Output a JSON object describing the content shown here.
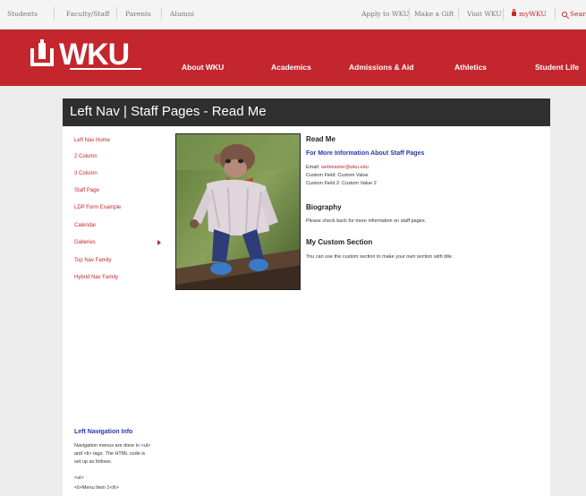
{
  "topbar": {
    "students": "Students",
    "faculty": "Faculty/Staff",
    "parents": "Parents",
    "alumni": "Alumni",
    "apply": "Apply to WKU",
    "gift": "Make a Gift",
    "visit": "Visit WKU",
    "mywku": "myWKU",
    "search": "Search"
  },
  "header": {
    "logo": "WKU",
    "nav": [
      "About WKU",
      "Academics",
      "Admissions & Aid",
      "Athletics",
      "Student Life"
    ]
  },
  "page": {
    "title": "Left Nav | Staff Pages - Read Me"
  },
  "leftnav": {
    "items": [
      "Left Nav Home",
      "2 Column",
      "3 Column",
      "Staff Page",
      "LDP Form Example",
      "Calendar",
      "Galleries",
      "Top Nav Family",
      "Hybrid Nav Family"
    ]
  },
  "readme": {
    "heading": "Read Me",
    "more_info": "For More Information About Staff Pages",
    "email_label": "Email:",
    "email": "webmaster@wku.edu",
    "custom1": "Custom Field:  Custom Value",
    "custom2": "Custom Field 2:  Custom Value 2",
    "bio_heading": "Biography",
    "bio_text": "Please check back for more information on staff pages.",
    "custom_heading": "My Custom Section",
    "custom_text": "You can use the custom section to make your own section with title."
  },
  "navinfo": {
    "heading": "Left Navigation Info",
    "lines": [
      "Navigation menus are done in <ul>",
      "and <li> tags.  The HTML code is",
      "set up as follows.",
      "<ul>",
      "<li>Menu Item 1</li>"
    ]
  },
  "colors": {
    "brand_red": "#c4262e",
    "title_bar": "#2f2f2f",
    "link_blue": "#2a38a8"
  }
}
